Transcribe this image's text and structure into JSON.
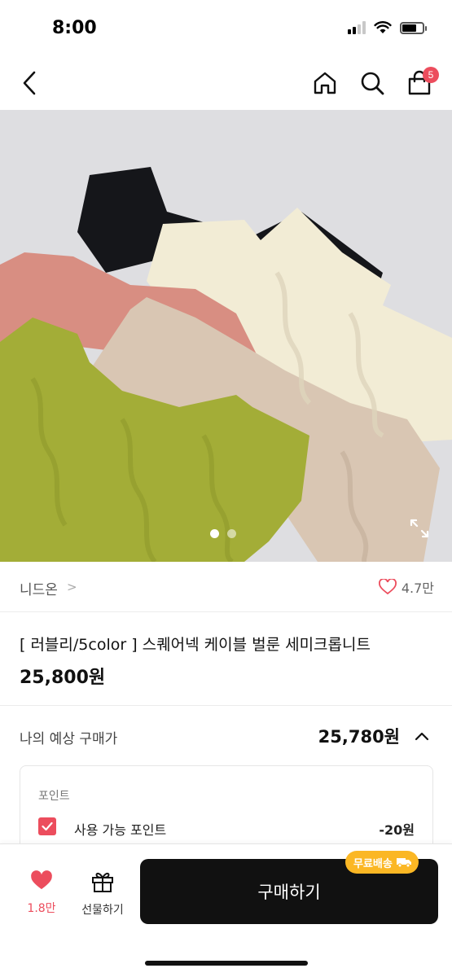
{
  "status_bar": {
    "time": "8:00"
  },
  "nav": {
    "back_icon": "chevron-left-icon",
    "home_icon": "home-icon",
    "search_icon": "search-icon",
    "cart_icon": "shopping-bag-icon",
    "cart_count": "5",
    "badge_color": "#ec4d5d"
  },
  "gallery": {
    "image_count": 2,
    "active_index": 0
  },
  "shop": {
    "name": "니드온",
    "chevron": ">",
    "likes": "4.7만"
  },
  "product": {
    "title": "[ 러블리/5color ] 스퀘어넥 케이블 벌룬 세미크롭니트",
    "price": "25,800원"
  },
  "estimate": {
    "label": "나의 예상 구매가",
    "value": "25,780원"
  },
  "points": {
    "label": "포인트",
    "item_label": "사용 가능 포인트",
    "item_value": "-20원",
    "checked": true
  },
  "bottom_bar": {
    "like_count": "1.8만",
    "gift_label": "선물하기",
    "buy_label": "구매하기",
    "free_shipping_label": "무료배송",
    "accent_color": "#ec4d5d",
    "shipping_badge_color": "#fbb724"
  }
}
